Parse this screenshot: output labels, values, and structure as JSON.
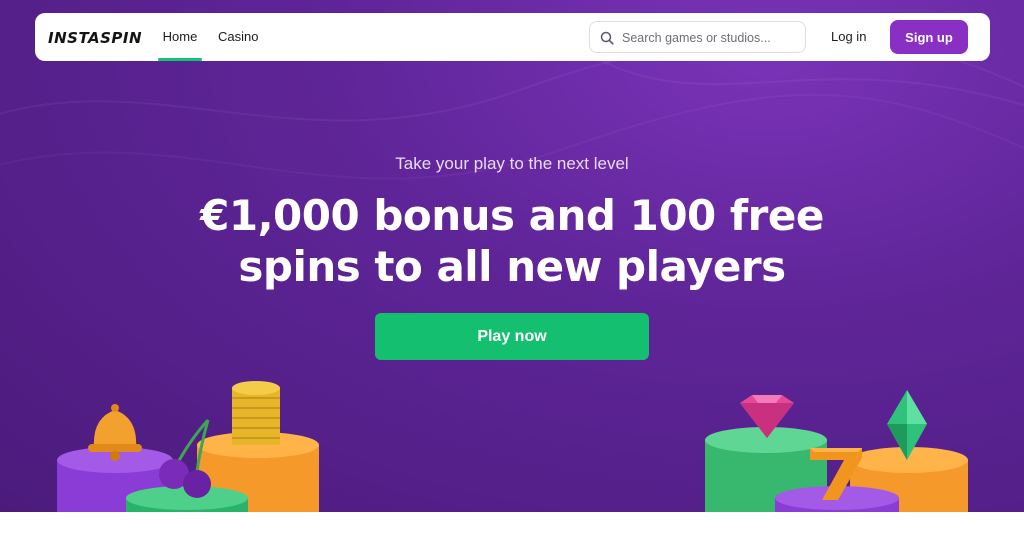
{
  "navbar": {
    "logo": "INSTASPIN",
    "links": [
      {
        "label": "Home",
        "active": true
      },
      {
        "label": "Casino",
        "active": false
      }
    ],
    "search": {
      "placeholder": "Search games or studios...",
      "value": ""
    },
    "login_label": "Log in",
    "signup_label": "Sign up"
  },
  "hero": {
    "tagline": "Take your play to the next level",
    "headline": "€1,000 bonus and 100 free spins to all new players",
    "cta_label": "Play now"
  },
  "colors": {
    "brand_purple": "#8a2fc4",
    "hero_background": "#5f2598",
    "cta_green": "#14c070",
    "active_underline": "#12c278"
  },
  "icons": [
    "search-icon",
    "bell-icon",
    "cherries-icon",
    "coin-stack-icon",
    "diamond-icon",
    "seven-icon",
    "green-gem-icon"
  ]
}
